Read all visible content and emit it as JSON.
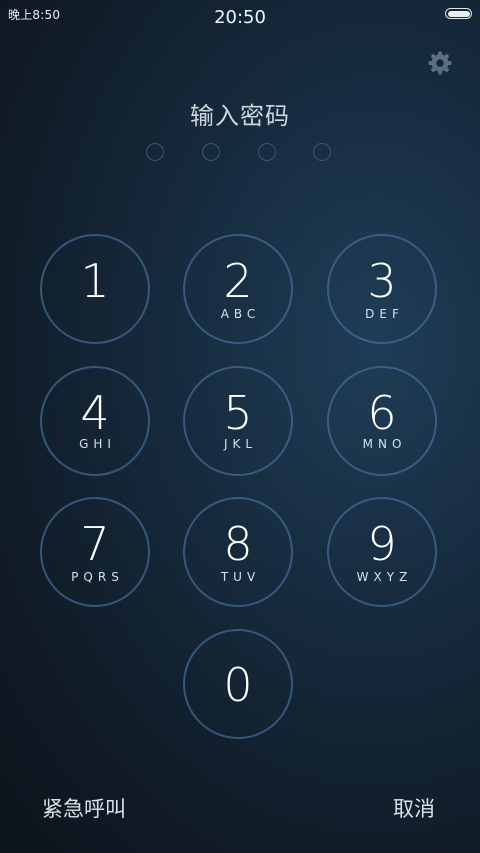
{
  "status_bar": {
    "left_text": "晚上8:50",
    "time": "20:50",
    "battery_level": 1.0,
    "battery_icon": "battery-icon"
  },
  "settings_icon": "gear-icon",
  "prompt": {
    "title": "输入密码",
    "pin_length": 4,
    "entered_count": 0
  },
  "keypad": {
    "keys": [
      {
        "digit": "1",
        "letters": ""
      },
      {
        "digit": "2",
        "letters": "ABC"
      },
      {
        "digit": "3",
        "letters": "DEF"
      },
      {
        "digit": "4",
        "letters": "GHI"
      },
      {
        "digit": "5",
        "letters": "JKL"
      },
      {
        "digit": "6",
        "letters": "MNO"
      },
      {
        "digit": "7",
        "letters": "PQRS"
      },
      {
        "digit": "8",
        "letters": "TUV"
      },
      {
        "digit": "9",
        "letters": "WXYZ"
      },
      {
        "digit": "0",
        "letters": ""
      }
    ]
  },
  "actions": {
    "emergency_label": "紧急呼叫",
    "cancel_label": "取消"
  },
  "colors": {
    "key_ring": "#4a78aa",
    "pin_dot_ring": "#3b5670",
    "text": "#ffffff"
  }
}
